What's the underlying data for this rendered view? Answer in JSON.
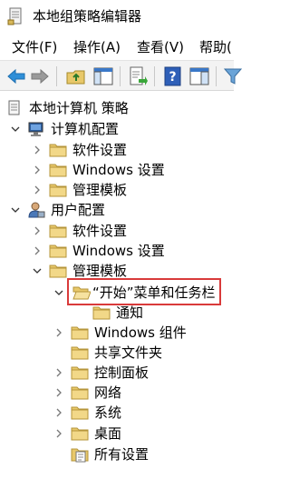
{
  "window": {
    "title": "本地组策略编辑器",
    "title_icon": "policy-editor-icon"
  },
  "menu": [
    {
      "label": "文件(F)"
    },
    {
      "label": "操作(A)"
    },
    {
      "label": "查看(V)"
    },
    {
      "label": "帮助("
    }
  ],
  "toolbar": {
    "buttons": [
      {
        "name": "back-arrow-icon"
      },
      {
        "name": "forward-arrow-icon"
      },
      {
        "name": "up-folder-icon"
      },
      {
        "name": "show-hide-tree-icon"
      },
      {
        "name": "export-list-icon"
      },
      {
        "name": "help-icon"
      },
      {
        "name": "properties-pane-icon"
      },
      {
        "name": "filter-icon"
      }
    ]
  },
  "tree": {
    "root": "本地计算机 策略",
    "computer_config": "计算机配置",
    "cc_software": "软件设置",
    "cc_windows": "Windows 设置",
    "cc_admin": "管理模板",
    "user_config": "用户配置",
    "uc_software": "软件设置",
    "uc_windows": "Windows 设置",
    "uc_admin": "管理模板",
    "start_menu": "“开始”菜单和任务栏",
    "notifications": "通知",
    "windows_components": "Windows 组件",
    "shared_folders": "共享文件夹",
    "control_panel": "控制面板",
    "network": "网络",
    "system": "系统",
    "desktop": "桌面",
    "all_settings": "所有设置"
  },
  "colors": {
    "highlight_border": "#d93a3a",
    "folder": "#e8c86a",
    "toolbar_bg": "#f3f3f3"
  }
}
